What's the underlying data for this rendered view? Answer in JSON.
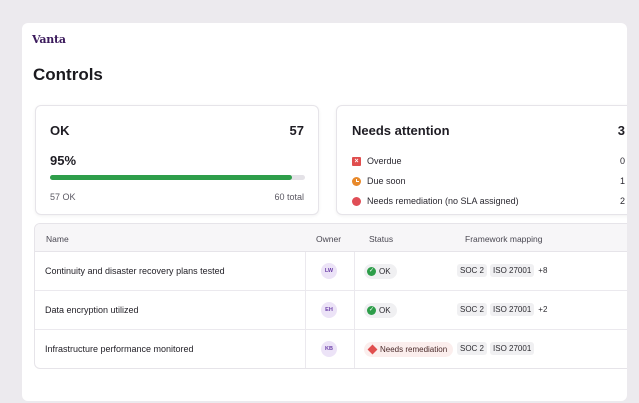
{
  "brand": {
    "logo": "Vanta"
  },
  "page": {
    "title": "Controls"
  },
  "ok_card": {
    "title": "OK",
    "count": "57",
    "percent": "95%",
    "progress_fraction": 0.95,
    "ok_label": "57 OK",
    "total_label": "60 total"
  },
  "attention_card": {
    "title": "Needs attention",
    "count": "3",
    "items": [
      {
        "label": "Overdue",
        "count": "0",
        "icon": "overdue-square-icon"
      },
      {
        "label": "Due soon",
        "count": "1",
        "icon": "clock-icon"
      },
      {
        "label": "Needs remediation (no SLA assigned)",
        "count": "2",
        "icon": "red-dot-icon"
      }
    ]
  },
  "table": {
    "columns": {
      "name": "Name",
      "owner": "Owner",
      "status": "Status",
      "framework": "Framework mapping"
    },
    "rows": [
      {
        "name": "Continuity and disaster recovery plans tested",
        "owner": "LW",
        "status": "OK",
        "frameworks": [
          "SOC 2",
          "ISO 27001"
        ],
        "more": "+8"
      },
      {
        "name": "Data encryption utilized",
        "owner": "EH",
        "status": "OK",
        "frameworks": [
          "SOC 2",
          "ISO 27001"
        ],
        "more": "+2"
      },
      {
        "name": "Infrastructure performance monitored",
        "owner": "KB",
        "status": "Needs remediation",
        "frameworks": [
          "SOC 2",
          "ISO 27001"
        ],
        "more": ""
      }
    ]
  },
  "colors": {
    "brand": "#3b1a5c",
    "ok_green": "#2e9e4a",
    "overdue_red": "#e04e4e",
    "due_soon_orange": "#e8892b",
    "avatar_bg": "#ece3f7"
  }
}
